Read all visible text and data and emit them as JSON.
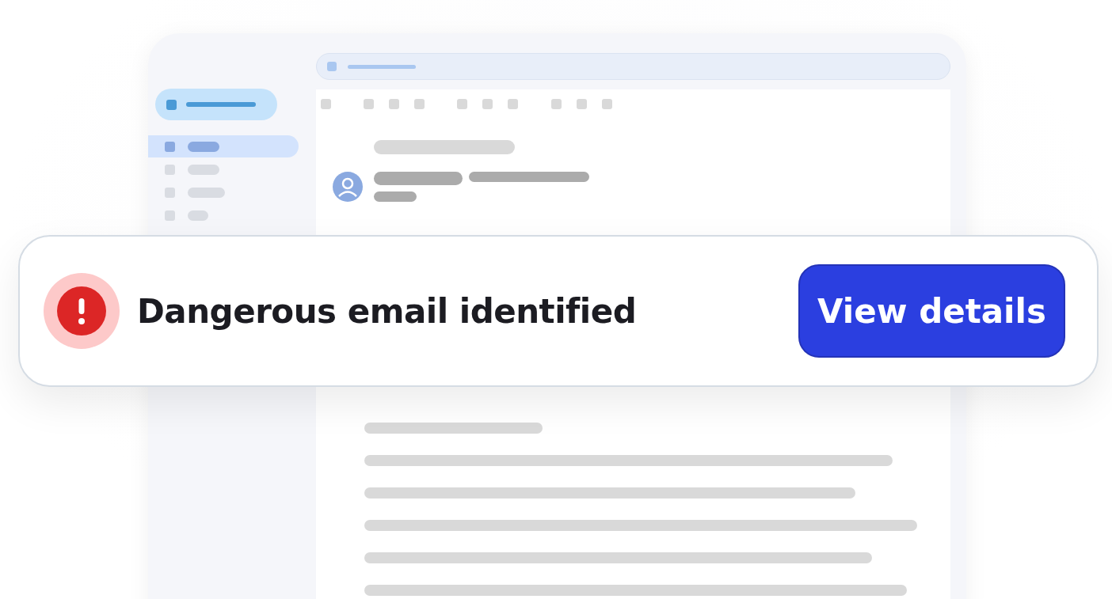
{
  "nav_items": [
    {
      "selected": true
    },
    {
      "selected": false
    },
    {
      "selected": false
    },
    {
      "selected": false
    }
  ],
  "alert": {
    "title": "Dangerous email identified",
    "button": "View details"
  }
}
